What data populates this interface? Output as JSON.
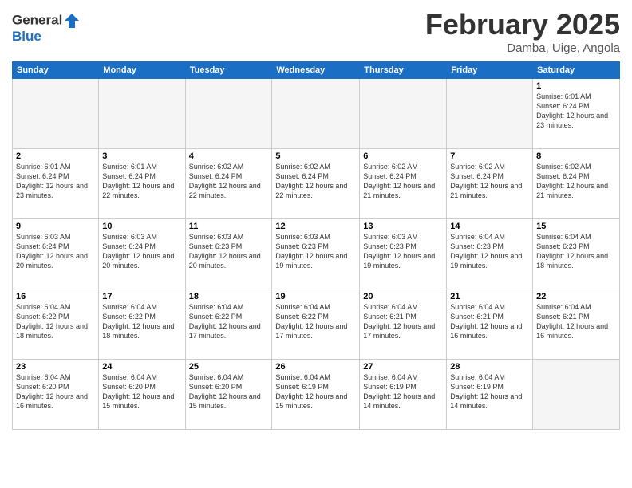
{
  "header": {
    "logo_line1": "General",
    "logo_line2": "Blue",
    "month": "February 2025",
    "location": "Damba, Uige, Angola"
  },
  "weekdays": [
    "Sunday",
    "Monday",
    "Tuesday",
    "Wednesday",
    "Thursday",
    "Friday",
    "Saturday"
  ],
  "weeks": [
    [
      {
        "day": "",
        "info": ""
      },
      {
        "day": "",
        "info": ""
      },
      {
        "day": "",
        "info": ""
      },
      {
        "day": "",
        "info": ""
      },
      {
        "day": "",
        "info": ""
      },
      {
        "day": "",
        "info": ""
      },
      {
        "day": "1",
        "info": "Sunrise: 6:01 AM\nSunset: 6:24 PM\nDaylight: 12 hours and 23 minutes."
      }
    ],
    [
      {
        "day": "2",
        "info": "Sunrise: 6:01 AM\nSunset: 6:24 PM\nDaylight: 12 hours and 23 minutes."
      },
      {
        "day": "3",
        "info": "Sunrise: 6:01 AM\nSunset: 6:24 PM\nDaylight: 12 hours and 22 minutes."
      },
      {
        "day": "4",
        "info": "Sunrise: 6:02 AM\nSunset: 6:24 PM\nDaylight: 12 hours and 22 minutes."
      },
      {
        "day": "5",
        "info": "Sunrise: 6:02 AM\nSunset: 6:24 PM\nDaylight: 12 hours and 22 minutes."
      },
      {
        "day": "6",
        "info": "Sunrise: 6:02 AM\nSunset: 6:24 PM\nDaylight: 12 hours and 21 minutes."
      },
      {
        "day": "7",
        "info": "Sunrise: 6:02 AM\nSunset: 6:24 PM\nDaylight: 12 hours and 21 minutes."
      },
      {
        "day": "8",
        "info": "Sunrise: 6:02 AM\nSunset: 6:24 PM\nDaylight: 12 hours and 21 minutes."
      }
    ],
    [
      {
        "day": "9",
        "info": "Sunrise: 6:03 AM\nSunset: 6:24 PM\nDaylight: 12 hours and 20 minutes."
      },
      {
        "day": "10",
        "info": "Sunrise: 6:03 AM\nSunset: 6:24 PM\nDaylight: 12 hours and 20 minutes."
      },
      {
        "day": "11",
        "info": "Sunrise: 6:03 AM\nSunset: 6:23 PM\nDaylight: 12 hours and 20 minutes."
      },
      {
        "day": "12",
        "info": "Sunrise: 6:03 AM\nSunset: 6:23 PM\nDaylight: 12 hours and 19 minutes."
      },
      {
        "day": "13",
        "info": "Sunrise: 6:03 AM\nSunset: 6:23 PM\nDaylight: 12 hours and 19 minutes."
      },
      {
        "day": "14",
        "info": "Sunrise: 6:04 AM\nSunset: 6:23 PM\nDaylight: 12 hours and 19 minutes."
      },
      {
        "day": "15",
        "info": "Sunrise: 6:04 AM\nSunset: 6:23 PM\nDaylight: 12 hours and 18 minutes."
      }
    ],
    [
      {
        "day": "16",
        "info": "Sunrise: 6:04 AM\nSunset: 6:22 PM\nDaylight: 12 hours and 18 minutes."
      },
      {
        "day": "17",
        "info": "Sunrise: 6:04 AM\nSunset: 6:22 PM\nDaylight: 12 hours and 18 minutes."
      },
      {
        "day": "18",
        "info": "Sunrise: 6:04 AM\nSunset: 6:22 PM\nDaylight: 12 hours and 17 minutes."
      },
      {
        "day": "19",
        "info": "Sunrise: 6:04 AM\nSunset: 6:22 PM\nDaylight: 12 hours and 17 minutes."
      },
      {
        "day": "20",
        "info": "Sunrise: 6:04 AM\nSunset: 6:21 PM\nDaylight: 12 hours and 17 minutes."
      },
      {
        "day": "21",
        "info": "Sunrise: 6:04 AM\nSunset: 6:21 PM\nDaylight: 12 hours and 16 minutes."
      },
      {
        "day": "22",
        "info": "Sunrise: 6:04 AM\nSunset: 6:21 PM\nDaylight: 12 hours and 16 minutes."
      }
    ],
    [
      {
        "day": "23",
        "info": "Sunrise: 6:04 AM\nSunset: 6:20 PM\nDaylight: 12 hours and 16 minutes."
      },
      {
        "day": "24",
        "info": "Sunrise: 6:04 AM\nSunset: 6:20 PM\nDaylight: 12 hours and 15 minutes."
      },
      {
        "day": "25",
        "info": "Sunrise: 6:04 AM\nSunset: 6:20 PM\nDaylight: 12 hours and 15 minutes."
      },
      {
        "day": "26",
        "info": "Sunrise: 6:04 AM\nSunset: 6:19 PM\nDaylight: 12 hours and 15 minutes."
      },
      {
        "day": "27",
        "info": "Sunrise: 6:04 AM\nSunset: 6:19 PM\nDaylight: 12 hours and 14 minutes."
      },
      {
        "day": "28",
        "info": "Sunrise: 6:04 AM\nSunset: 6:19 PM\nDaylight: 12 hours and 14 minutes."
      },
      {
        "day": "",
        "info": ""
      }
    ]
  ]
}
